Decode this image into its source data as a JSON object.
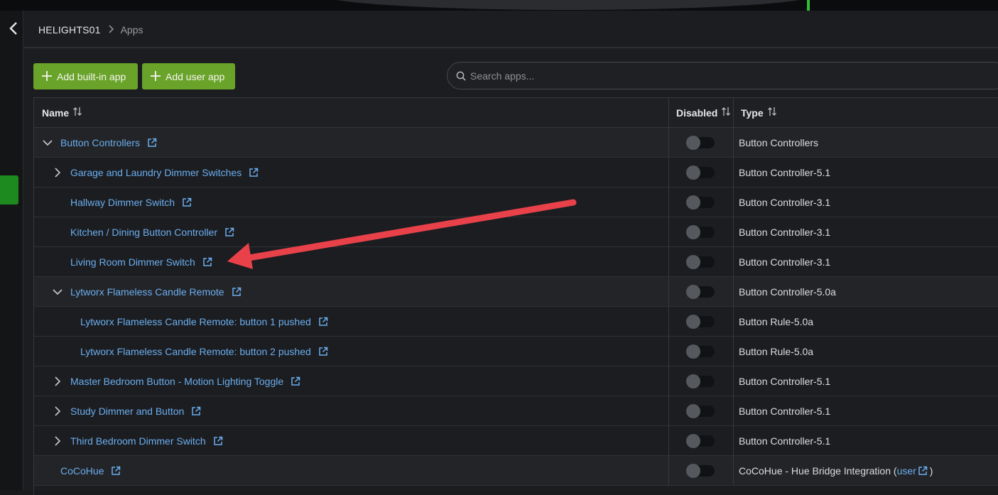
{
  "breadcrumb": {
    "root": "HELIGHTS01",
    "current": "Apps"
  },
  "toolbar": {
    "add_builtin": "Add built-in app",
    "add_user": "Add user app"
  },
  "search": {
    "placeholder": "Search apps..."
  },
  "table": {
    "headers": {
      "name": "Name",
      "disabled": "Disabled",
      "type": "Type"
    },
    "rows": [
      {
        "name": "Button Controllers",
        "type": "Button Controllers",
        "expand": "expanded",
        "depth": 0
      },
      {
        "name": "Garage and Laundry Dimmer Switches",
        "type": "Button Controller-5.1",
        "expand": "collapsed",
        "depth": 1
      },
      {
        "name": "Hallway Dimmer Switch",
        "type": "Button Controller-3.1",
        "expand": "none",
        "depth": 1
      },
      {
        "name": "Kitchen / Dining Button Controller",
        "type": "Button Controller-3.1",
        "expand": "none",
        "depth": 1
      },
      {
        "name": "Living Room Dimmer Switch",
        "type": "Button Controller-3.1",
        "expand": "none",
        "depth": 1
      },
      {
        "name": "Lytworx Flameless Candle Remote",
        "type": "Button Controller-5.0a",
        "expand": "expanded",
        "depth": 1
      },
      {
        "name": "Lytworx Flameless Candle Remote: button 1 pushed",
        "type": "Button Rule-5.0a",
        "expand": "none",
        "depth": 2
      },
      {
        "name": "Lytworx Flameless Candle Remote: button 2 pushed",
        "type": "Button Rule-5.0a",
        "expand": "none",
        "depth": 2
      },
      {
        "name": "Master Bedroom Button - Motion Lighting Toggle",
        "type": "Button Controller-5.1",
        "expand": "collapsed",
        "depth": 1
      },
      {
        "name": "Study Dimmer and Button",
        "type": "Button Controller-5.1",
        "expand": "collapsed",
        "depth": 1
      },
      {
        "name": "Third Bedroom Dimmer Switch",
        "type": "Button Controller-5.1",
        "expand": "collapsed",
        "depth": 1
      },
      {
        "name": "CoCoHue",
        "type": "CoCoHue - Hue Bridge Integration (",
        "type_link": "user",
        "type_suffix": ")",
        "expand": "none",
        "depth": 0
      }
    ]
  },
  "colors": {
    "accent_green": "#6aa329",
    "link_blue": "#6aaef0",
    "annotation_arrow": "#e8414a"
  },
  "icons": {
    "back": "chevron-left-icon",
    "crumb_separator": "chevron-right-icon",
    "add": "plus-icon",
    "search": "search-icon",
    "sort": "sort-arrows-icon",
    "external": "external-link-icon",
    "expanded": "chevron-down-icon",
    "collapsed": "chevron-right-icon"
  }
}
